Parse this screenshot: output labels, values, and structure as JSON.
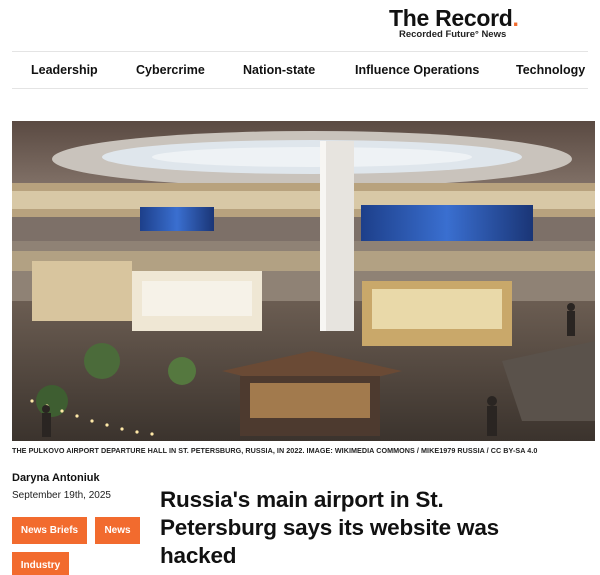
{
  "brand": {
    "name": "The Record",
    "dot": ".",
    "subtitle": "Recorded Future° News"
  },
  "nav": {
    "items": [
      "Leadership",
      "Cybercrime",
      "Nation-state",
      "Influence Operations",
      "Technology"
    ]
  },
  "article": {
    "image_caption": "THE PULKOVO AIRPORT DEPARTURE HALL IN ST. PETERSBURG, RUSSIA, IN 2022. IMAGE: WIKIMEDIA COMMONS / MIKE1979 RUSSIA / CC BY-SA 4.0",
    "author": "Daryna Antoniuk",
    "date": "September 19th, 2025",
    "tags": [
      "News Briefs",
      "News",
      "Industry"
    ],
    "headline_lines": [
      "Russia's main airport in St.",
      "Petersburg says its website was",
      "hacked"
    ]
  },
  "colors": {
    "accent": "#f26b2e",
    "text": "#111111",
    "divider": "#e4e4e4"
  }
}
